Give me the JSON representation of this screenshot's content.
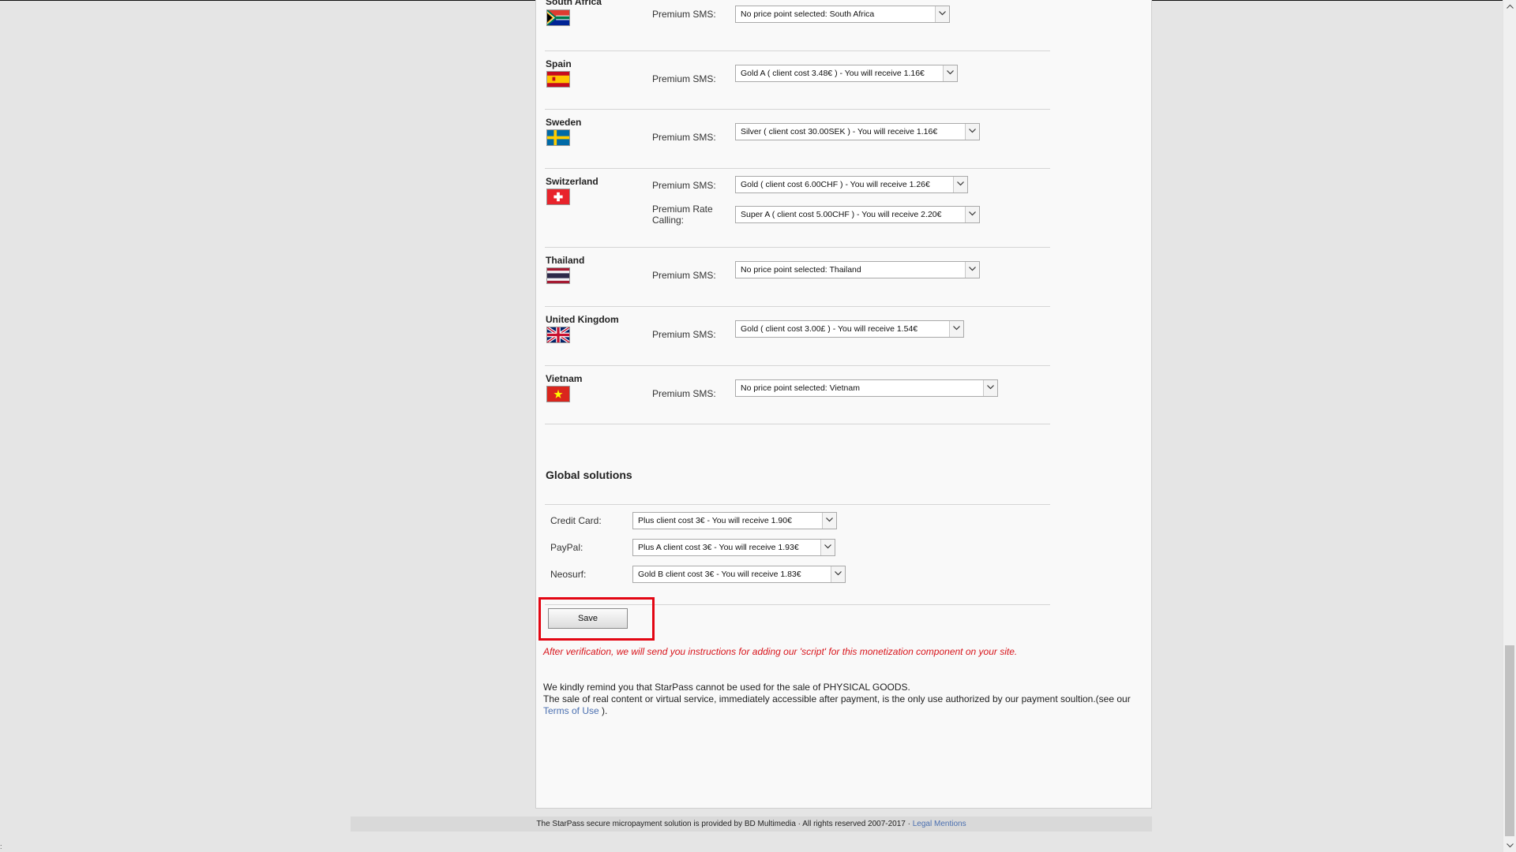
{
  "countries": [
    {
      "name": "South Africa",
      "flag_icon": "south-africa-flag-icon",
      "methods": [
        {
          "label": "Premium SMS:",
          "value": "No price point selected: South Africa"
        }
      ]
    },
    {
      "name": "Spain",
      "flag_icon": "spain-flag-icon",
      "methods": [
        {
          "label": "Premium SMS:",
          "value": "Gold A ( client cost 3.48€ ) - You will receive 1.16€"
        }
      ]
    },
    {
      "name": "Sweden",
      "flag_icon": "sweden-flag-icon",
      "methods": [
        {
          "label": "Premium SMS:",
          "value": "Silver ( client cost 30.00SEK ) - You will receive 1.16€"
        }
      ]
    },
    {
      "name": "Switzerland",
      "flag_icon": "switzerland-flag-icon",
      "methods": [
        {
          "label": "Premium SMS:",
          "value": "Gold ( client cost 6.00CHF ) - You will receive 1.26€"
        },
        {
          "label": "Premium Rate Calling:",
          "value": "Super A ( client cost 5.00CHF ) - You will receive 2.20€"
        }
      ]
    },
    {
      "name": "Thailand",
      "flag_icon": "thailand-flag-icon",
      "methods": [
        {
          "label": "Premium SMS:",
          "value": "No price point selected: Thailand"
        }
      ]
    },
    {
      "name": "United Kingdom",
      "flag_icon": "united-kingdom-flag-icon",
      "methods": [
        {
          "label": "Premium SMS:",
          "value": "Gold ( client cost 3.00£ ) - You will receive 1.54€"
        }
      ]
    },
    {
      "name": "Vietnam",
      "flag_icon": "vietnam-flag-icon",
      "methods": [
        {
          "label": "Premium SMS:",
          "value": "No price point selected: Vietnam"
        }
      ]
    }
  ],
  "global": {
    "title": "Global solutions",
    "items": [
      {
        "label": "Credit Card:",
        "value": "Plus client cost 3€ - You will receive 1.90€"
      },
      {
        "label": "PayPal:",
        "value": "Plus A client cost 3€ - You will receive 1.93€"
      },
      {
        "label": "Neosurf:",
        "value": "Gold B client cost 3€ - You will receive 1.83€"
      }
    ]
  },
  "save_label": "Save",
  "verification_note": "After verification, we will send you instructions for adding our 'script' for this monetization component on your site.",
  "reminder": {
    "line1": "We kindly remind you that StarPass cannot be used for the sale of PHYSICAL GOODS.",
    "line2_a": "The sale of real content or virtual service, immediately accessible after payment, is the only use authorized by our payment soultion.(see our",
    "terms_link": "Terms of Use",
    "line2_b": ")."
  },
  "footer": {
    "text": "The StarPass secure micropayment solution is provided by BD Multimedia · All rights reserved 2007-2017 ·",
    "link": "Legal Mentions"
  },
  "colors": {
    "highlight": "#e30613",
    "note_red": "#d8141b",
    "link": "#4a6fb0"
  }
}
